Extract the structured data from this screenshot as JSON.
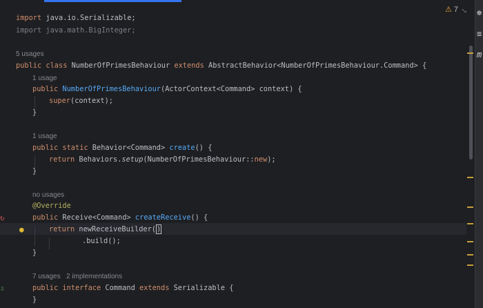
{
  "inspection": {
    "warning_glyph": "⚠",
    "count": "7"
  },
  "right_panel": {
    "icon1": "☸",
    "icon2": "≡",
    "icon3": "m"
  },
  "hints": {
    "class": "5 usages",
    "ctor": "1 usage",
    "create": "1 usage",
    "receive": "no usages",
    "command_usages": "7 usages",
    "command_impls": "2 implementations"
  },
  "code": {
    "l1": {
      "kw": "import",
      "rest": " java.io.Serializable;"
    },
    "l2": {
      "text": "import java.math.BigInteger;"
    },
    "l4": {
      "public": "public",
      "class": "class",
      "name": " NumberOfPrimesBehaviour ",
      "extends": "extends",
      "rest": " AbstractBehavior<NumberOfPrimesBehaviour.Command> {"
    },
    "l6": {
      "public": "public",
      "fn": "NumberOfPrimesBehaviour",
      "rest": "(ActorContext<Command> context) {"
    },
    "l7": {
      "super": "super",
      "rest": "(context);"
    },
    "l8": {
      "brace": "}"
    },
    "l10": {
      "public": "public",
      "static": "static",
      "type": " Behavior<Command> ",
      "fn": "create",
      "rest": "() {"
    },
    "l11": {
      "return": "return",
      "pre": " Behaviors.",
      "setup": "setup",
      "mid": "(NumberOfPrimesBehaviour::",
      "new": "new",
      "end": ");"
    },
    "l12": {
      "brace": "}"
    },
    "l14": {
      "annotation": "@Override"
    },
    "l15": {
      "public": "public",
      "type": " Receive<Command> ",
      "fn": "createReceive",
      "rest": "() {"
    },
    "l16": {
      "return": "return",
      "pre": " newReceiveBuilder(",
      "caret": ")"
    },
    "l17": {
      "text": ".build();"
    },
    "l18": {
      "brace": "}"
    },
    "l20": {
      "public": "public",
      "interface": "interface",
      "name": " Command ",
      "extends": "extends",
      "rest": " Serializable {"
    },
    "l21": {
      "brace": "}"
    }
  }
}
